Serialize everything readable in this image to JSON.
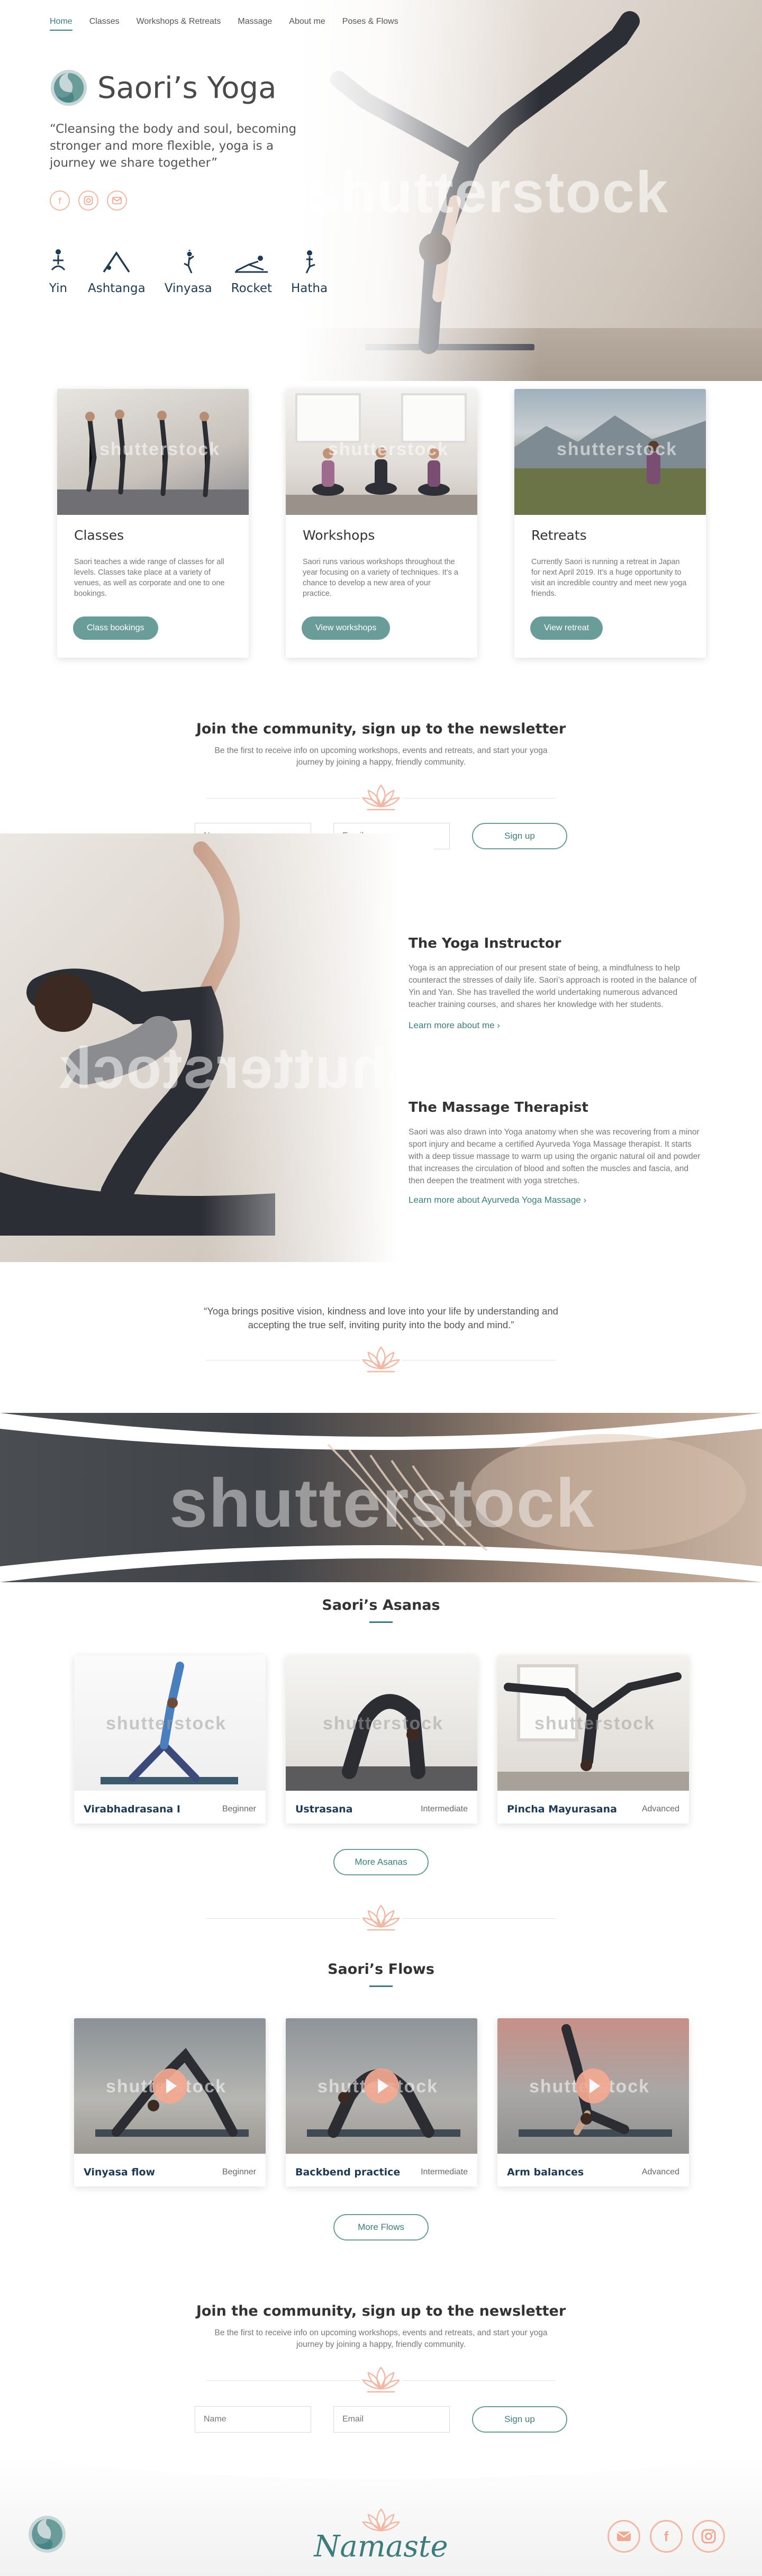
{
  "nav": {
    "items": [
      {
        "label": "Home",
        "active": true
      },
      {
        "label": "Classes"
      },
      {
        "label": "Workshops & Retreats"
      },
      {
        "label": "Massage"
      },
      {
        "label": "About me"
      },
      {
        "label": "Poses & Flows"
      }
    ]
  },
  "hero": {
    "title": "Saori’s Yoga",
    "tagline": "“Cleansing the body and soul, becoming stronger and more flexible, yoga is a journey we share together”",
    "watermark": "shutterstock",
    "social_icons": [
      "facebook-icon",
      "instagram-icon",
      "email-icon"
    ],
    "styles": [
      {
        "label": "Yin",
        "icon": "yin-pose-icon"
      },
      {
        "label": "Ashtanga",
        "icon": "ashtanga-pose-icon"
      },
      {
        "label": "Vinyasa",
        "icon": "vinyasa-pose-icon"
      },
      {
        "label": "Rocket",
        "icon": "rocket-pose-icon"
      },
      {
        "label": "Hatha",
        "icon": "hatha-pose-icon"
      }
    ]
  },
  "cards": [
    {
      "title": "Classes",
      "text": "Saori teaches a wide range of classes for all levels. Classes take place at a variety of venues, as well as corporate and one to one bookings.",
      "button": "Class bookings",
      "watermark": "shutterstock"
    },
    {
      "title": "Workshops",
      "text": "Saori runs various workshops throughout the year focusing on a variety of techniques. It’s a chance to develop a new area of your practice.",
      "button": "View workshops",
      "watermark": "shutterstock"
    },
    {
      "title": "Retreats",
      "text": "Currently Saori is running a retreat in Japan for next April 2019. It’s a huge opportunity to visit an incredible country and meet new yoga friends.",
      "button": "View retreat",
      "watermark": "shutterstock"
    }
  ],
  "newsletter": {
    "title": "Join the community, sign up to the newsletter",
    "text": "Be the first to receive info on upcoming workshops, events and retreats, and start your yoga journey by joining a happy, friendly community.",
    "name_placeholder": "Name",
    "email_placeholder": "Email",
    "button": "Sign up"
  },
  "about": {
    "watermark": "shutterstock",
    "instructor_title": "The Yoga Instructor",
    "instructor_text": "Yoga is an appreciation of our present state of being, a mindfulness to help counteract the stresses of daily life. Saori’s approach is rooted in the balance of Yin and Yan. She has travelled the world undertaking numerous advanced teacher training courses, and shares her knowledge with her students.",
    "instructor_link": "Learn more about me",
    "massage_title": "The Massage Therapist",
    "massage_text": "Saori was also drawn into Yoga anatomy when she was recovering from a minor sport injury and became a certified Ayurveda Yoga Massage therapist. It starts with a deep tissue massage to warm up using the organic natural oil and powder that increases the circulation of blood and soften the muscles and fascia, and then deepen the treatment with yoga stretches.",
    "massage_link": "Learn more about Ayurveda Yoga Massage"
  },
  "quote": "“Yoga brings positive vision, kindness and love into your life by understanding and accepting the true self, inviting purity into the body and mind.”",
  "banner_watermark": "shutterstock",
  "asanas": {
    "title": "Saori’s Asanas",
    "items": [
      {
        "name": "Virabhadrasana I",
        "level": "Beginner",
        "watermark": "shutterstock"
      },
      {
        "name": "Ustrasana",
        "level": "Intermediate",
        "watermark": "shutterstock"
      },
      {
        "name": "Pincha Mayurasana",
        "level": "Advanced",
        "watermark": "shutterstock"
      }
    ],
    "button": "More Asanas"
  },
  "flows": {
    "title": "Saori’s Flows",
    "items": [
      {
        "name": "Vinyasa flow",
        "level": "Beginner",
        "watermark": "shutterstock"
      },
      {
        "name": "Backbend practice",
        "level": "Intermediate",
        "watermark": "shutterstock"
      },
      {
        "name": "Arm balances",
        "level": "Advanced",
        "watermark": "shutterstock"
      }
    ],
    "button": "More Flows"
  },
  "newsletter2": {
    "title": "Join the community, sign up to the newsletter",
    "text": "Be the first to receive info on upcoming workshops, events and retreats, and start your yoga journey by joining a happy, friendly community.",
    "name_placeholder": "Name",
    "email_placeholder": "Email",
    "button": "Sign up"
  },
  "footer": {
    "signature": "Namaste",
    "social_icons": [
      "email-icon",
      "facebook-icon",
      "instagram-icon"
    ]
  },
  "colors": {
    "teal": "#3d7c7d",
    "button": "#6a9c9a",
    "accent_peach": "#f3b8a4",
    "navy": "#1f3b53"
  }
}
